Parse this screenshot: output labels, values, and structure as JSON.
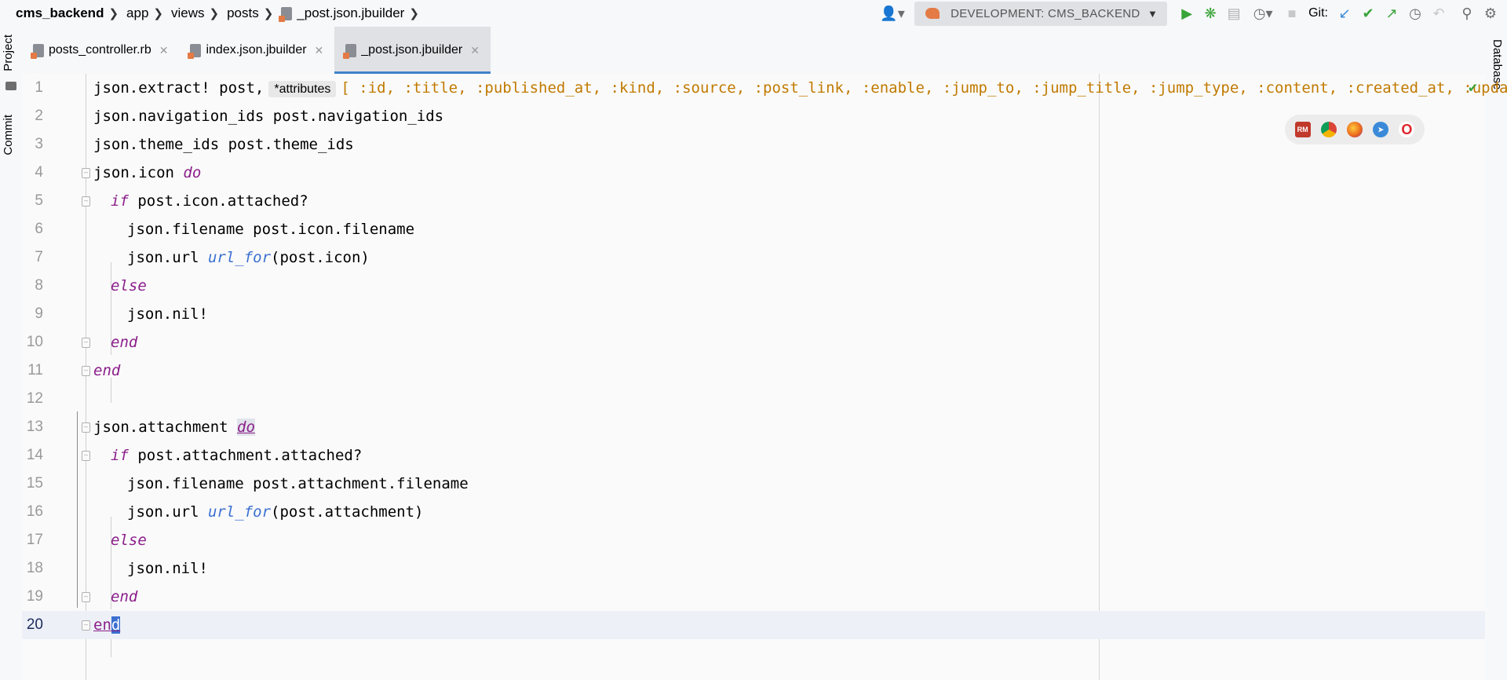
{
  "breadcrumb": {
    "project": "cms_backend",
    "parts": [
      "app",
      "views",
      "posts"
    ],
    "file": "_post.json.jbuilder"
  },
  "toolbar": {
    "run_config": "DEVELOPMENT: CMS_BACKEND",
    "git_label": "Git:",
    "icons": [
      "user-icon",
      "run-icon",
      "debug-icon",
      "coverage-icon",
      "profile-icon",
      "stop-icon",
      "git-update-icon",
      "git-commit-icon",
      "git-push-icon",
      "history-icon",
      "rollback-icon",
      "search-icon",
      "settings-icon"
    ]
  },
  "tabs": [
    {
      "label": "posts_controller.rb",
      "active": false
    },
    {
      "label": "index.json.jbuilder",
      "active": false
    },
    {
      "label": "_post.json.jbuilder",
      "active": true
    }
  ],
  "left_panel": {
    "project_label": "Project",
    "commit_label": "Commit"
  },
  "right_panel": {
    "database_label": "Database"
  },
  "editor": {
    "inlay_hint": "*attributes",
    "current_line": 20,
    "line_numbers": [
      "1",
      "2",
      "3",
      "4",
      "5",
      "6",
      "7",
      "8",
      "9",
      "10",
      "11",
      "12",
      "13",
      "14",
      "15",
      "16",
      "17",
      "18",
      "19",
      "20"
    ],
    "line1_head": "json.extract! post,",
    "line1_tail": "[ :id, :title, :published_at, :kind, :source, :post_link, :enable, :jump_to, :jump_title, :jump_type, :content, :created_at, :updated",
    "line2": "json.navigation_ids post.navigation_ids",
    "line3": "json.theme_ids post.theme_ids",
    "line4_a": "json.icon ",
    "line4_kw": "do",
    "line5_kw": "if",
    "line5_b": " post.icon.attached?",
    "line6": "json.filename post.icon.filename",
    "line7_a": "json.url ",
    "line7_m": "url_for",
    "line7_b": "(post.icon)",
    "line8": "else",
    "line9": "json.nil!",
    "line10": "end",
    "line11": "end",
    "line13_a": "json.attachment ",
    "line13_kw": "do",
    "line14_kw": "if",
    "line14_b": " post.attachment.attached?",
    "line15": "json.filename post.attachment.filename",
    "line16_a": "json.url ",
    "line16_m": "url_for",
    "line16_b": "(post.attachment)",
    "line17": "else",
    "line18": "json.nil!",
    "line19": "end",
    "line20_a": "en",
    "line20_b": "d"
  },
  "browsers": [
    {
      "name": "RubyMine",
      "abbr": "RM",
      "color": "#c0392b"
    },
    {
      "name": "Chrome",
      "abbr": "",
      "color": "#e8a21b"
    },
    {
      "name": "Firefox",
      "abbr": "",
      "color": "#e8641b"
    },
    {
      "name": "Safari",
      "abbr": "",
      "color": "#3b8ad9"
    },
    {
      "name": "Opera",
      "abbr": "O",
      "color": "#e0242c"
    }
  ],
  "colors": {
    "keyword": "#8b1f8b",
    "method": "#3a6fd0",
    "symbol": "#c17a00",
    "accent": "#4083c9"
  }
}
